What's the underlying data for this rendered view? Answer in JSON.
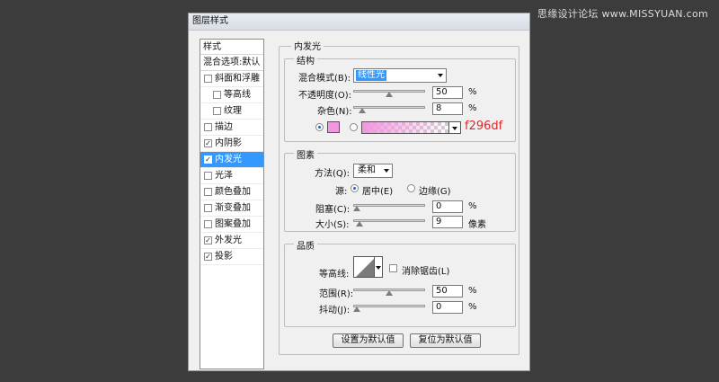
{
  "watermark": "思缘设计论坛 www.MISSYUAN.com",
  "dialog": {
    "title": "图层样式"
  },
  "style_list": {
    "header": "样式",
    "blend": "混合选项:默认",
    "items": [
      {
        "label": "斜面和浮雕",
        "checked": false,
        "indent": false,
        "active": false
      },
      {
        "label": "等高线",
        "checked": false,
        "indent": true,
        "active": false
      },
      {
        "label": "纹理",
        "checked": false,
        "indent": true,
        "active": false
      },
      {
        "label": "描边",
        "checked": false,
        "indent": false,
        "active": false
      },
      {
        "label": "内阴影",
        "checked": true,
        "indent": false,
        "active": false
      },
      {
        "label": "内发光",
        "checked": true,
        "indent": false,
        "active": true
      },
      {
        "label": "光泽",
        "checked": false,
        "indent": false,
        "active": false
      },
      {
        "label": "颜色叠加",
        "checked": false,
        "indent": false,
        "active": false
      },
      {
        "label": "渐变叠加",
        "checked": false,
        "indent": false,
        "active": false
      },
      {
        "label": "图案叠加",
        "checked": false,
        "indent": false,
        "active": false
      },
      {
        "label": "外发光",
        "checked": true,
        "indent": false,
        "active": false
      },
      {
        "label": "投影",
        "checked": true,
        "indent": false,
        "active": false
      }
    ]
  },
  "panel": {
    "title": "内发光",
    "structure": {
      "title": "结构",
      "blend_mode_label": "混合模式(B):",
      "blend_mode_value": "线性光",
      "opacity_label": "不透明度(O):",
      "opacity_value": "50",
      "opacity_unit": "%",
      "opacity_fraction": 0.5,
      "noise_label": "杂色(N):",
      "noise_value": "8",
      "noise_unit": "%",
      "noise_fraction": 0.08,
      "glow_color": "#f296df",
      "color_note": "f296df"
    },
    "elements": {
      "title": "图素",
      "method_label": "方法(Q):",
      "method_value": "柔和",
      "source_label": "源:",
      "source_center": "居中(E)",
      "source_edge": "边缘(G)",
      "choke_label": "阻塞(C):",
      "choke_value": "0",
      "choke_unit": "%",
      "choke_fraction": 0,
      "size_label": "大小(S):",
      "size_value": "9",
      "size_unit": "像素",
      "size_fraction": 0.036
    },
    "quality": {
      "title": "品质",
      "contour_label": "等高线:",
      "antialias_label": "消除锯齿(L)",
      "range_label": "范围(R):",
      "range_value": "50",
      "range_unit": "%",
      "range_fraction": 0.5,
      "jitter_label": "抖动(J):",
      "jitter_value": "0",
      "jitter_unit": "%",
      "jitter_fraction": 0
    },
    "buttons": {
      "make_default": "设置为默认值",
      "reset_default": "复位为默认值"
    }
  }
}
